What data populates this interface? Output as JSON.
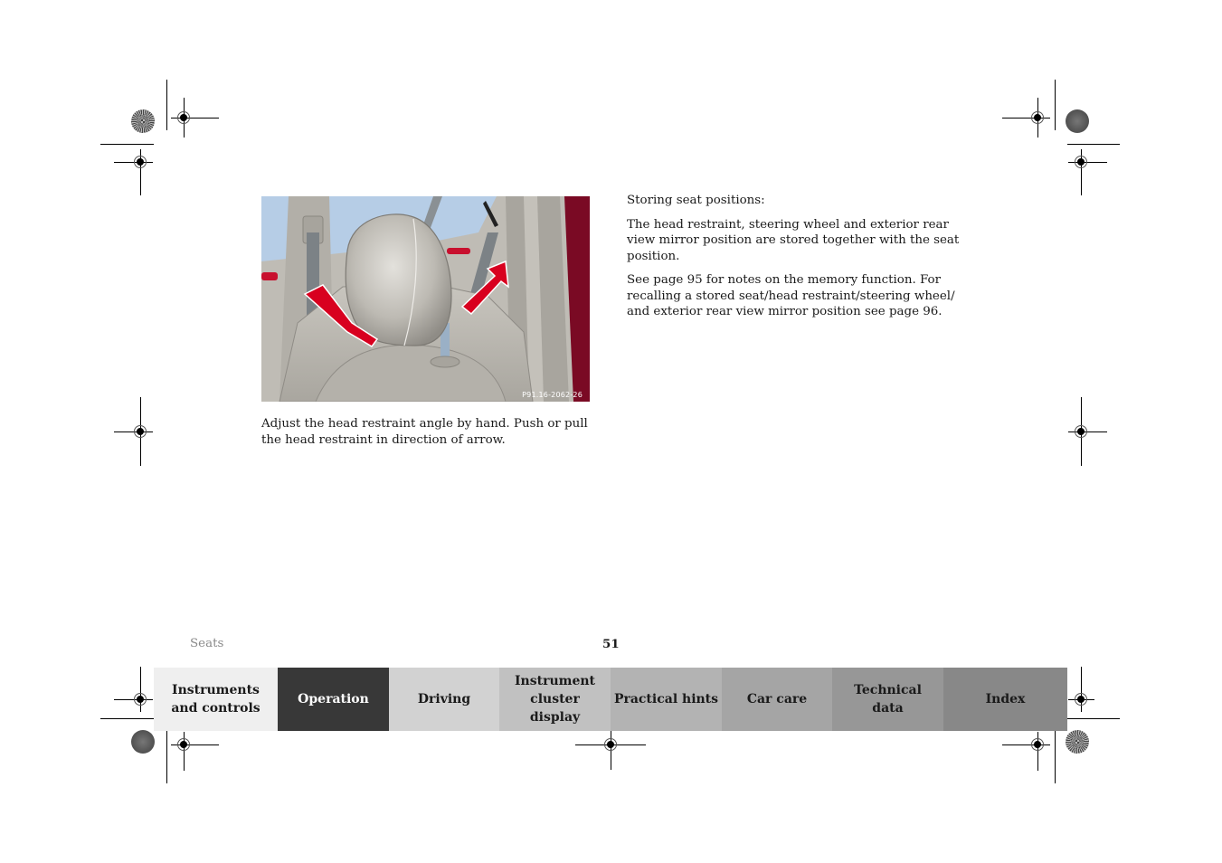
{
  "figure": {
    "code": "P91.16-2062-26",
    "alt": "Head restraint with red arrows indicating tilt direction"
  },
  "caption": "Adjust the head restraint angle by hand. Push or pull the head restraint in direction of arrow.",
  "right_column": {
    "heading": "Storing seat positions:",
    "paragraphs": [
      "The head restraint, steering wheel and exterior rear view mirror position are stored together with the seat position.",
      "See page 95 for notes on the memory function. For recalling a stored seat/head restraint/steering wheel/ and exterior rear view mirror position see page 96."
    ]
  },
  "footer": {
    "section": "Seats",
    "page_number": "51"
  },
  "tabs": [
    {
      "label": "Instruments and controls",
      "bg": "#efefef",
      "fg": "#1a1a1a",
      "active": false
    },
    {
      "label": "Operation",
      "bg": "#383838",
      "fg": "#ffffff",
      "active": true
    },
    {
      "label": "Driving",
      "bg": "#d2d2d2",
      "fg": "#1a1a1a",
      "active": false
    },
    {
      "label": "Instrument cluster display",
      "bg": "#c1c1c1",
      "fg": "#1a1a1a",
      "active": false
    },
    {
      "label": "Practical hints",
      "bg": "#b3b3b3",
      "fg": "#1a1a1a",
      "active": false
    },
    {
      "label": "Car care",
      "bg": "#a5a5a5",
      "fg": "#1a1a1a",
      "active": false
    },
    {
      "label": "Technical data",
      "bg": "#979797",
      "fg": "#1a1a1a",
      "active": false
    },
    {
      "label": "Index",
      "bg": "#888888",
      "fg": "#1a1a1a",
      "active": false
    }
  ],
  "colors": {
    "arrow_red": "#d8001f",
    "door_red": "#7a0a24"
  }
}
